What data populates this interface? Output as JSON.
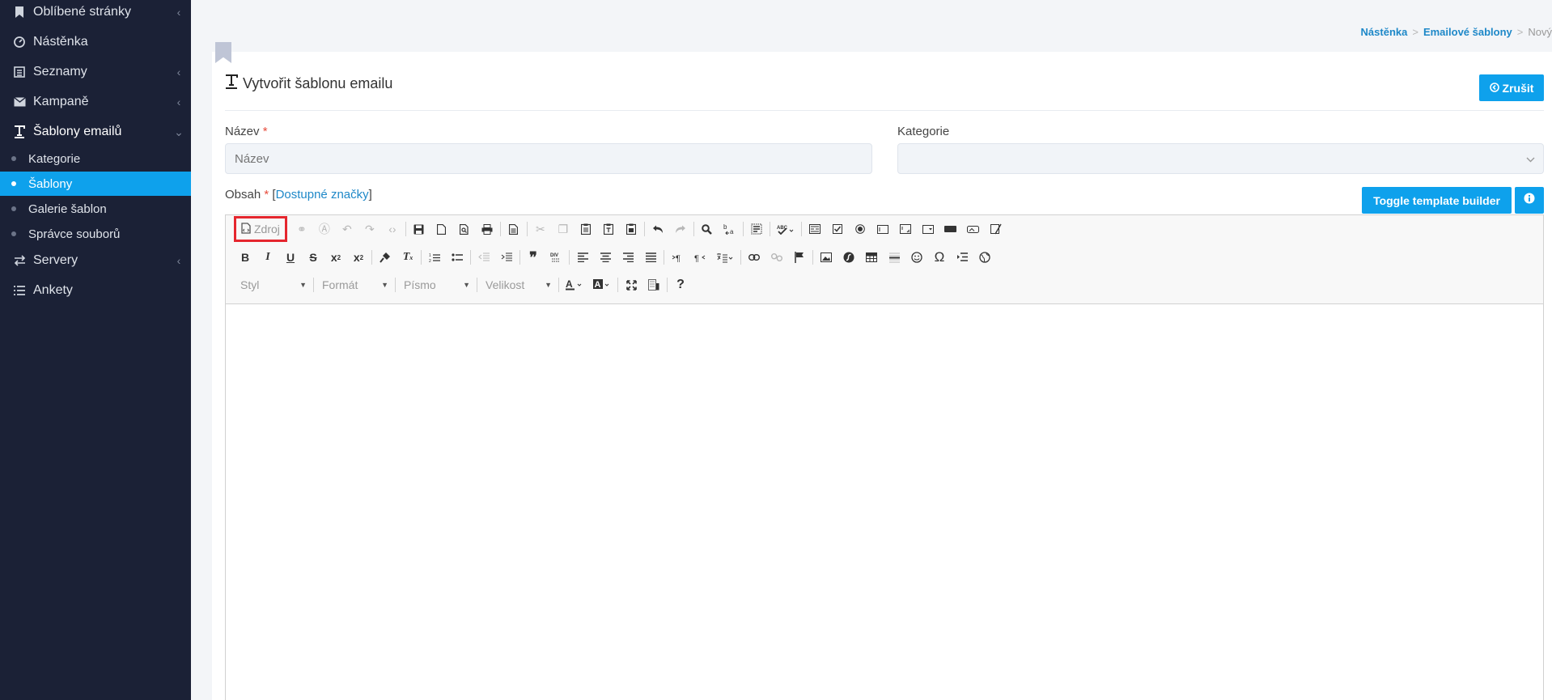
{
  "sidebar": {
    "items": [
      {
        "label": "Oblíbené stránky",
        "icon": "bookmark-icon"
      },
      {
        "label": "Nástěnka",
        "icon": "dashboard-icon"
      },
      {
        "label": "Seznamy",
        "icon": "list-icon"
      },
      {
        "label": "Kampaně",
        "icon": "envelope-icon"
      },
      {
        "label": "Šablony emailů",
        "icon": "text-icon"
      },
      {
        "label": "Servery",
        "icon": "exchange-icon"
      },
      {
        "label": "Ankety",
        "icon": "poll-list-icon"
      }
    ],
    "subitems": [
      {
        "label": "Kategorie"
      },
      {
        "label": "Šablony"
      },
      {
        "label": "Galerie šablon"
      },
      {
        "label": "Správce souborů"
      }
    ]
  },
  "breadcrumb": {
    "items": [
      "Nástěnka",
      "Emailové šablony",
      "Nový"
    ]
  },
  "page": {
    "title": "Vytvořit šablonu emailu",
    "cancel_label": "Zrušit"
  },
  "form": {
    "name_label": "Název",
    "required_mark": "*",
    "name_placeholder": "Název",
    "category_label": "Kategorie",
    "category_value": "",
    "content_label": "Obsah",
    "bracket_open": "[",
    "tags_link": "Dostupné značky",
    "bracket_close": "]",
    "toggle_builder_label": "Toggle template builder"
  },
  "editor": {
    "source_label": "Zdroj",
    "combos": {
      "style": "Styl",
      "format": "Formát",
      "font": "Písmo",
      "size": "Velikost"
    },
    "help_label": "?"
  },
  "colors": {
    "sidebar_bg": "#1b2136",
    "accent": "#0ea1ec",
    "highlight_border": "#e5262e"
  }
}
